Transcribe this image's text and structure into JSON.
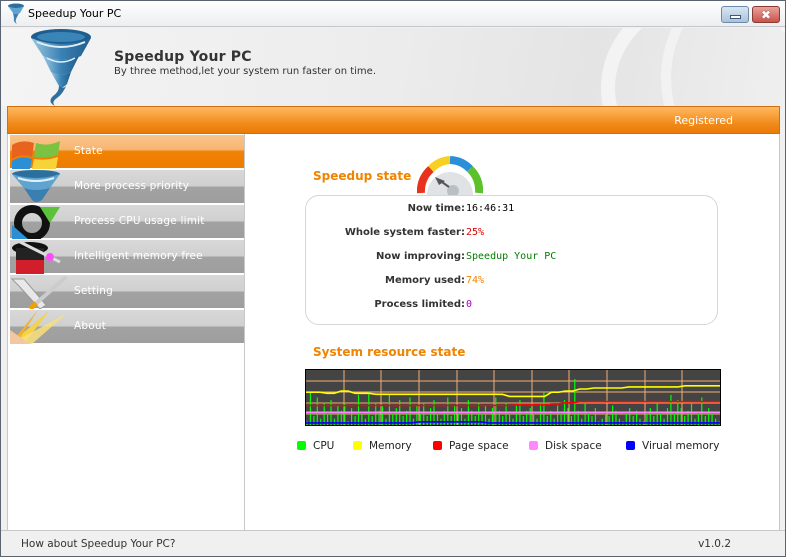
{
  "window": {
    "title": "Speedup Your PC",
    "minimize_label": "minimize",
    "close_label": "✖"
  },
  "header": {
    "title": "Speedup Your PC",
    "subtitle": "By three method,let your system run faster on time."
  },
  "banner": {
    "status": "Registered",
    "accent_color": "#f08300"
  },
  "sidebar": {
    "items": [
      {
        "label": "State",
        "icon": "windows-logo-icon",
        "active": true
      },
      {
        "label": "More process priority",
        "icon": "tornado-icon",
        "active": false
      },
      {
        "label": "Process CPU usage limit",
        "icon": "refresh-arrows-icon",
        "active": false
      },
      {
        "label": "Intelligent memory free",
        "icon": "magic-hat-icon",
        "active": false
      },
      {
        "label": "Setting",
        "icon": "wrench-screwdriver-icon",
        "active": false
      },
      {
        "label": "About",
        "icon": "light-burst-icon",
        "active": false
      }
    ]
  },
  "speedup_state": {
    "title": "Speedup state",
    "rows": [
      {
        "label": "Now time:",
        "value": "16:46:31",
        "color": "#000000"
      },
      {
        "label": "Whole system faster:",
        "value": "25%",
        "color": "#e00000"
      },
      {
        "label": "Now improving:",
        "value": "Speedup Your PC",
        "color": "#008000"
      },
      {
        "label": "Memory used:",
        "value": "74%",
        "color": "#f08300"
      },
      {
        "label": "Process limited:",
        "value": "0",
        "color": "#a000c0"
      }
    ]
  },
  "resource_state": {
    "title": "System resource state",
    "legend": [
      {
        "label": "CPU",
        "color": "#00ff00"
      },
      {
        "label": "Memory",
        "color": "#ffff00"
      },
      {
        "label": "Page space",
        "color": "#ff0000"
      },
      {
        "label": "Disk space",
        "color": "#ff88ff"
      },
      {
        "label": "Virual memory",
        "color": "#0000ff"
      }
    ]
  },
  "chart_data": {
    "type": "line",
    "title": "System resource state",
    "xlabel": "",
    "ylabel": "",
    "ylim": [
      0,
      100
    ],
    "grid": true,
    "legend_position": "bottom",
    "series": [
      {
        "name": "CPU",
        "color": "#00ff00",
        "values": [
          5,
          60,
          15,
          50,
          10,
          40,
          20,
          45,
          10,
          35,
          25,
          40,
          5,
          30,
          15,
          55,
          20,
          10,
          60,
          15,
          40,
          25,
          35,
          10,
          55,
          20,
          30,
          45,
          15,
          25,
          50,
          10,
          35,
          20,
          40,
          15,
          30,
          45,
          20,
          10,
          25,
          50,
          15,
          35,
          20,
          30,
          10,
          45,
          25,
          15,
          40,
          20,
          35,
          10,
          30,
          50,
          25,
          15,
          40,
          20,
          10,
          35,
          45,
          15,
          25,
          30,
          20,
          10,
          40,
          60,
          15,
          25,
          10,
          35,
          20,
          45,
          30,
          15,
          85,
          25,
          10,
          40,
          20,
          15,
          30,
          5,
          10,
          20,
          15,
          35,
          25,
          10,
          5,
          20,
          30,
          15,
          25,
          10,
          5,
          20,
          30,
          15,
          40,
          20,
          10,
          30,
          55,
          20,
          45,
          30,
          15,
          25,
          40,
          10,
          20,
          50,
          15,
          30,
          20,
          10,
          5
        ]
      },
      {
        "name": "Memory",
        "color": "#ffff00",
        "values": [
          60,
          60,
          60,
          58,
          58,
          62,
          62,
          58,
          58,
          58,
          56,
          56,
          56,
          56,
          56,
          56,
          56,
          56,
          56,
          56,
          56,
          56,
          56,
          56,
          56,
          56,
          56,
          56,
          56,
          52,
          52,
          52,
          52,
          52,
          52,
          60,
          60,
          62,
          62,
          66,
          66,
          68,
          68,
          68,
          68,
          68,
          70,
          70,
          70,
          70,
          70,
          70,
          70,
          70,
          72,
          72,
          72,
          72,
          72,
          72
        ]
      },
      {
        "name": "Page space",
        "color": "#ff0000",
        "values": [
          35,
          35,
          35,
          35,
          35,
          35,
          35,
          35,
          35,
          35,
          35,
          35,
          35,
          35,
          35,
          35,
          35,
          35,
          35,
          35,
          35,
          35,
          35,
          35,
          35,
          35,
          35,
          35,
          35,
          35,
          36,
          36,
          36,
          36,
          36,
          38,
          38,
          40,
          40,
          42,
          42,
          42,
          42,
          42,
          42,
          42,
          42,
          42,
          42,
          42,
          42,
          42,
          42,
          42,
          42,
          42,
          42,
          42,
          42,
          42
        ]
      },
      {
        "name": "Disk space",
        "color": "#ff88ff",
        "values": [
          22,
          22,
          22,
          22,
          22,
          22,
          22,
          22,
          22,
          22,
          22,
          22,
          22,
          22,
          22,
          22,
          22,
          22,
          22,
          22,
          22,
          22,
          22,
          22,
          22,
          22,
          22,
          22,
          22,
          22,
          22,
          22,
          22,
          22,
          22,
          22,
          22,
          22,
          22,
          22,
          22,
          22,
          22,
          22,
          22,
          22,
          22,
          22,
          22,
          22,
          22,
          22,
          22,
          22,
          22,
          22,
          22,
          22,
          22,
          22
        ]
      },
      {
        "name": "Virual memory",
        "color": "#0000ff",
        "values": [
          2,
          2,
          2,
          2,
          2,
          2,
          2,
          2,
          2,
          2,
          2,
          2,
          2,
          2,
          2,
          2,
          4,
          4,
          4,
          4,
          4,
          4,
          4,
          4,
          4,
          4,
          2,
          2,
          2,
          2,
          2,
          2,
          2,
          2,
          2,
          2,
          2,
          2,
          2,
          2,
          2,
          2,
          2,
          2,
          2,
          2,
          2,
          2,
          2,
          2,
          2,
          2,
          2,
          2,
          2,
          2,
          2,
          2,
          2,
          2
        ]
      }
    ]
  },
  "statusbar": {
    "message": "How about Speedup Your PC?",
    "version": "v1.0.2"
  }
}
